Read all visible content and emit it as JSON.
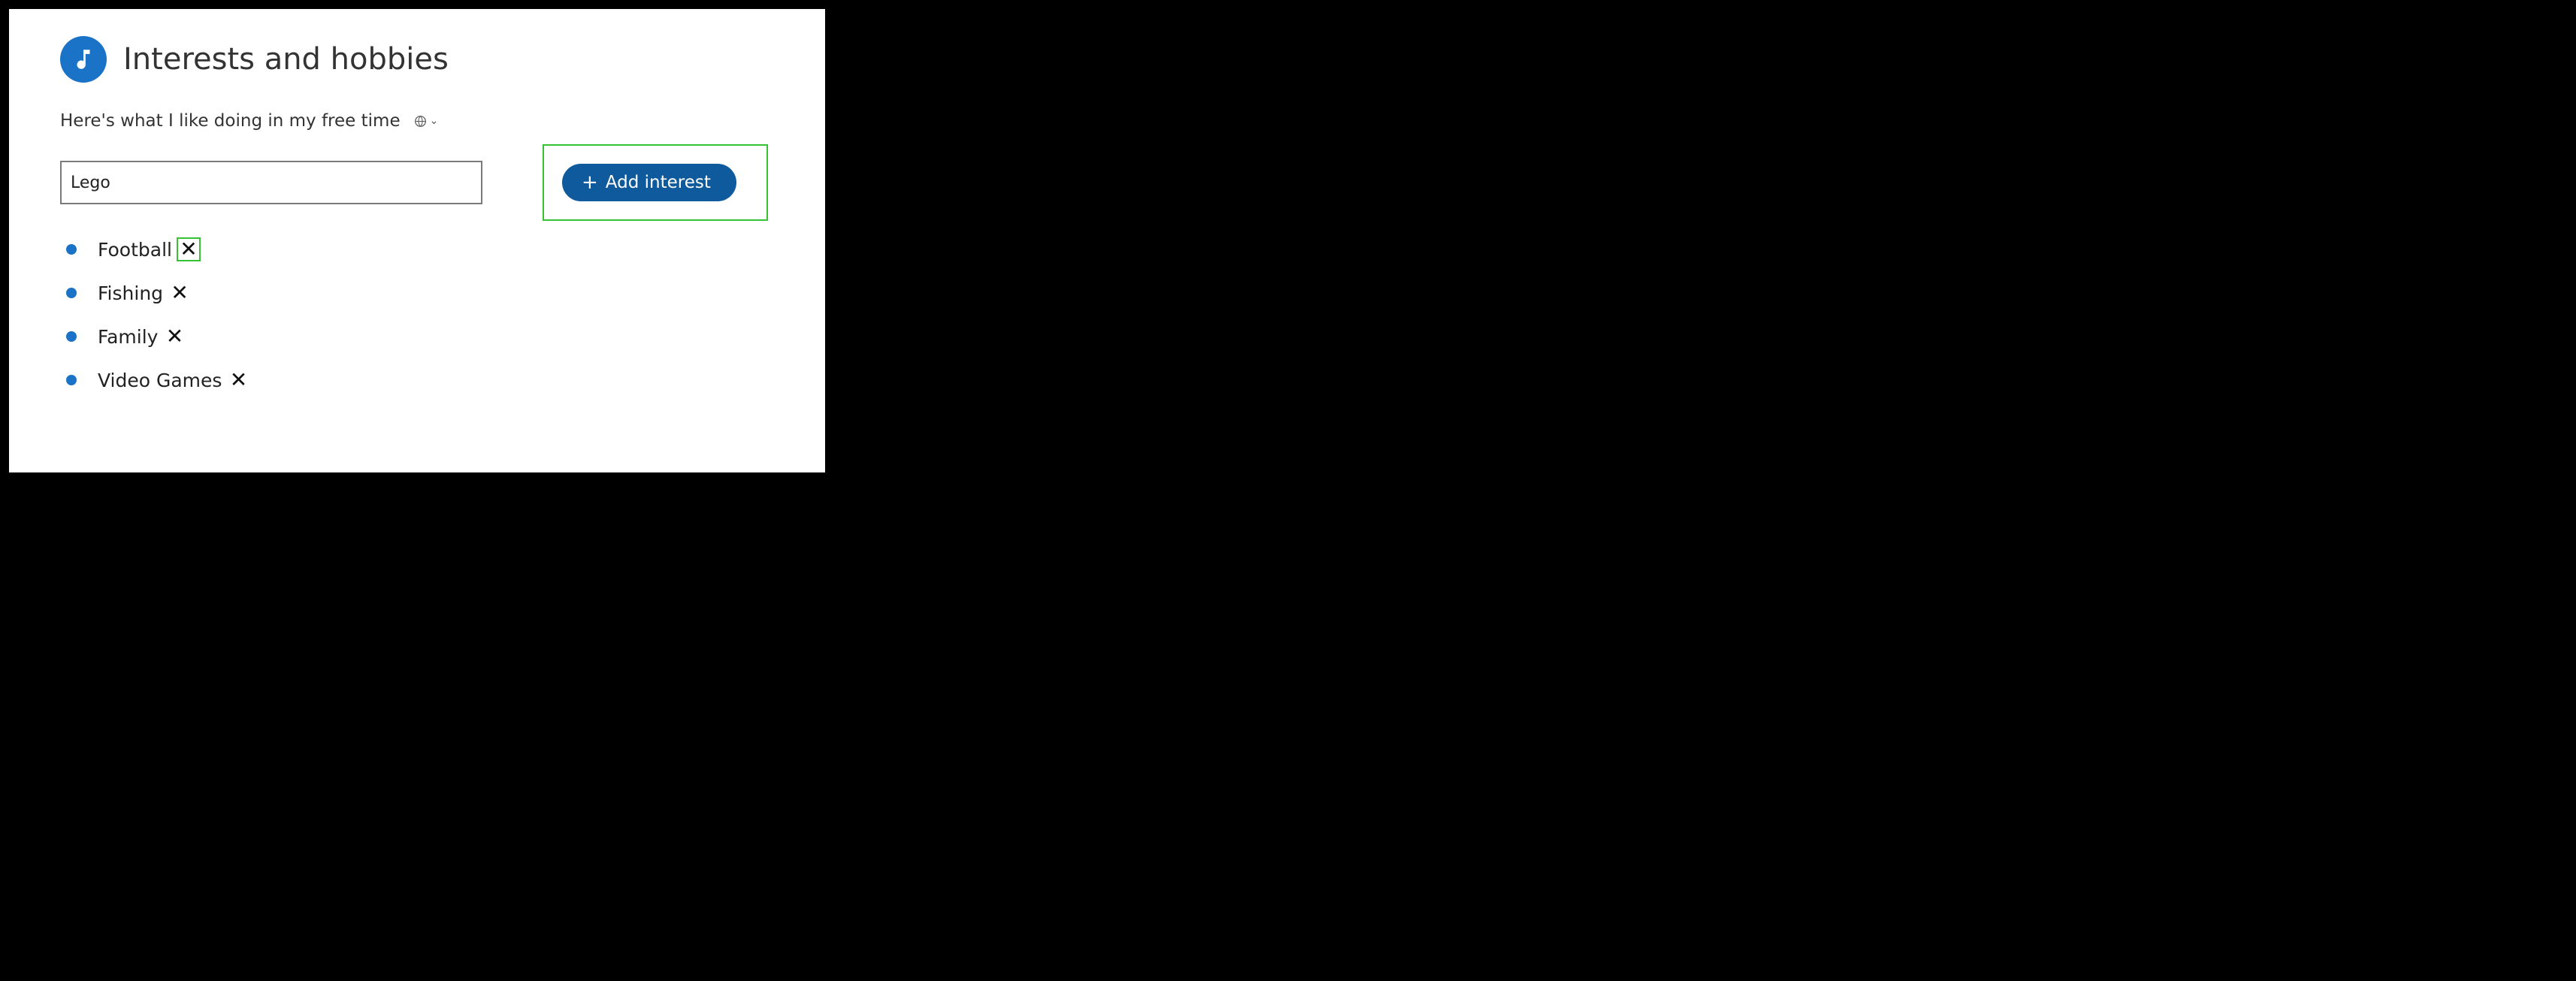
{
  "colors": {
    "accent": "#1a73c7",
    "button": "#0e5a9c",
    "highlight": "#35c235"
  },
  "header": {
    "icon": "music-icon",
    "title": "Interests and hobbies"
  },
  "subtitle": {
    "text": "Here's what I like doing in my free time",
    "privacy_icon": "globe-icon"
  },
  "input": {
    "value": "Lego"
  },
  "add_button": {
    "icon": "plus-icon",
    "label": "Add interest"
  },
  "interests": [
    {
      "label": "Football",
      "remove_highlight": true
    },
    {
      "label": "Fishing",
      "remove_highlight": false
    },
    {
      "label": "Family",
      "remove_highlight": false
    },
    {
      "label": "Video Games",
      "remove_highlight": false
    }
  ]
}
